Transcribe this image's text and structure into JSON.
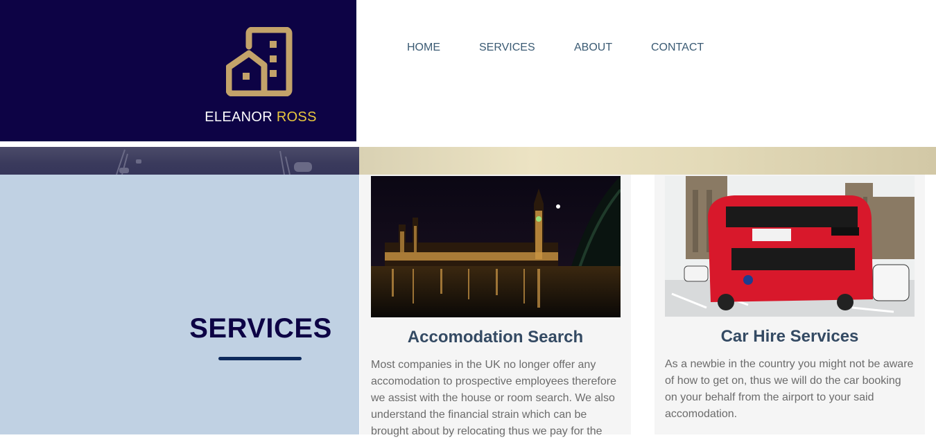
{
  "brand": {
    "first_name": "ELEANOR",
    "last_name": "ROSS",
    "logo_icon": "building-house-icon",
    "accent_color": "#e9c83e",
    "logo_color": "#c3a36a",
    "background": "#0d0345"
  },
  "nav": {
    "items": [
      {
        "label": "HOME"
      },
      {
        "label": "SERVICES"
      },
      {
        "label": "ABOUT"
      },
      {
        "label": "CONTACT"
      }
    ]
  },
  "services": {
    "heading": "SERVICES",
    "cards": [
      {
        "title": "Accomodation Search",
        "image": "night-westminster-photo",
        "text": "Most companies in the UK no longer offer any accomodation to prospective employees therefore we assist with the house or room search. We also understand the financial strain which can be brought about by relocating thus we pay for the"
      },
      {
        "title": "Car Hire Services",
        "image": "red-double-decker-bus-photo",
        "text": "As a newbie in the country you might not be aware of how to get on, thus we will do the car booking on your behalf from the airport to your said accomodation."
      }
    ]
  }
}
